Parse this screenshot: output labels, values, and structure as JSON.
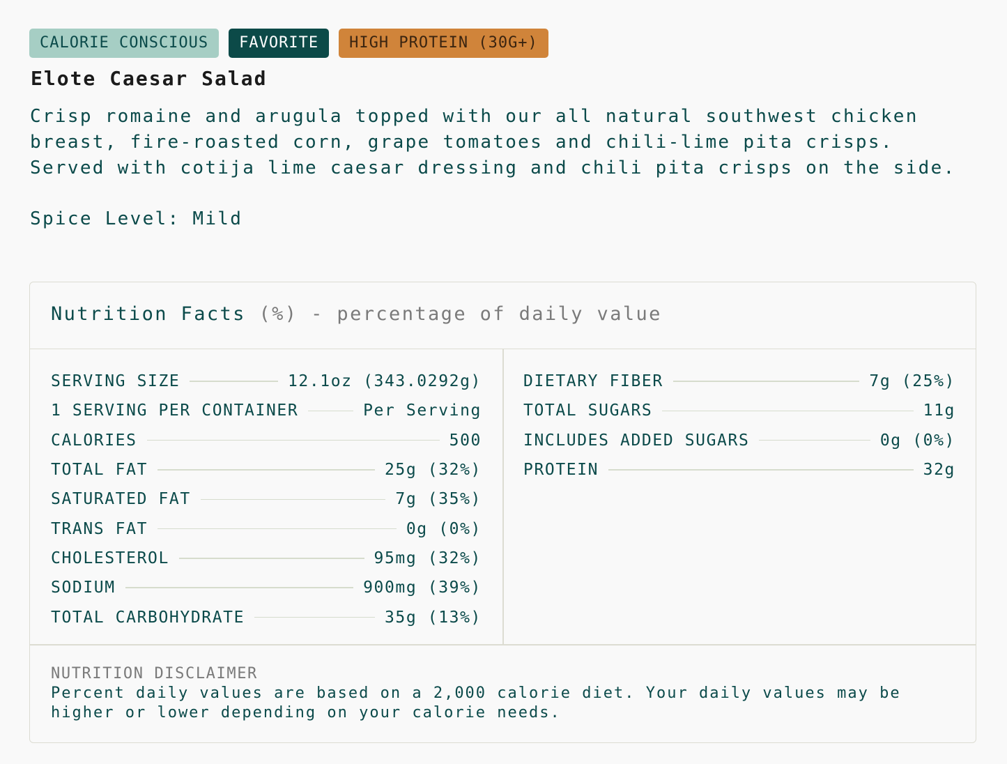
{
  "tags": [
    {
      "label": "CALORIE CONSCIOUS",
      "color": "#a6cec4"
    },
    {
      "label": "FAVORITE",
      "color": "#0c4a48"
    },
    {
      "label": "HIGH PROTEIN (30G+)",
      "color": "#d0843a"
    }
  ],
  "item": {
    "title": "Elote Caesar Salad",
    "description": "Crisp romaine and arugula topped with our all natural southwest chicken breast, fire-roasted corn, grape tomatoes and chili-lime pita crisps. Served with cotija lime caesar dressing and chili pita crisps on the side.",
    "spice_level": "Spice Level: Mild"
  },
  "nutrition": {
    "heading": "Nutrition Facts",
    "heading_note": "(%) - percentage of daily value",
    "left_rows": [
      {
        "label": "SERVING SIZE",
        "value": "12.1oz (343.0292g)"
      },
      {
        "label": "1 SERVING PER CONTAINER",
        "value": "Per Serving"
      },
      {
        "label": "CALORIES",
        "value": "500"
      },
      {
        "label": "TOTAL FAT",
        "value": "25g (32%)"
      },
      {
        "label": "SATURATED FAT",
        "value": "7g (35%)"
      },
      {
        "label": "TRANS FAT",
        "value": "0g (0%)"
      },
      {
        "label": "CHOLESTEROL",
        "value": "95mg (32%)"
      },
      {
        "label": "SODIUM",
        "value": "900mg (39%)"
      },
      {
        "label": "TOTAL CARBOHYDRATE",
        "value": "35g (13%)"
      }
    ],
    "right_rows": [
      {
        "label": "DIETARY FIBER",
        "value": "7g (25%)"
      },
      {
        "label": "TOTAL SUGARS",
        "value": "11g"
      },
      {
        "label": "INCLUDES ADDED SUGARS",
        "value": "0g (0%)"
      },
      {
        "label": "PROTEIN",
        "value": "32g"
      }
    ],
    "disclaimer_title": "NUTRITION DISCLAIMER",
    "disclaimer_text": "Percent daily values are based on a 2,000 calorie diet. Your daily values may be higher or lower depending on your calorie needs."
  }
}
